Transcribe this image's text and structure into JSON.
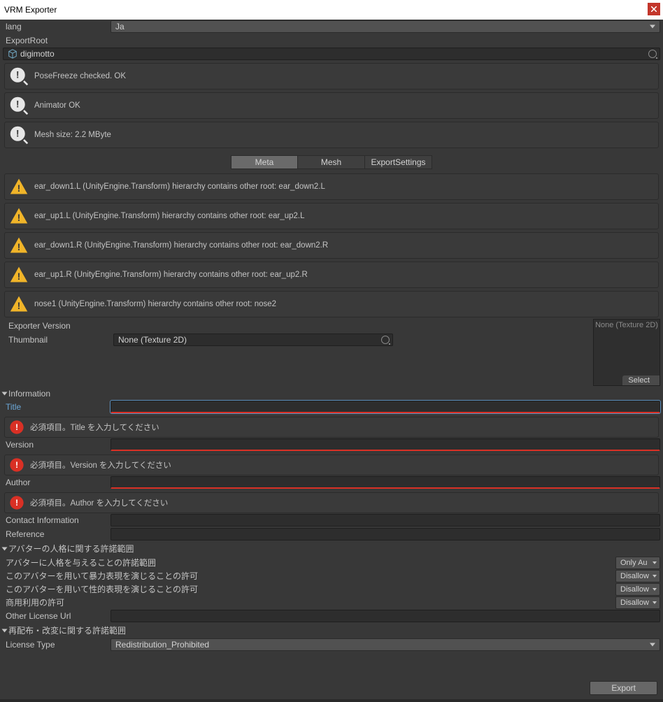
{
  "window": {
    "title": "VRM Exporter"
  },
  "lang": {
    "label": "lang",
    "value": "Ja"
  },
  "exportRoot": {
    "label": "ExportRoot",
    "value": "digimotto"
  },
  "infos": [
    "PoseFreeze checked. OK",
    "Animator OK",
    "Mesh size: 2.2 MByte"
  ],
  "tabs": {
    "meta": "Meta",
    "mesh": "Mesh",
    "export": "ExportSettings"
  },
  "warnings": [
    "ear_down1.L (UnityEngine.Transform) hierarchy contains other root: ear_down2.L",
    "ear_up1.L (UnityEngine.Transform) hierarchy contains other root: ear_up2.L",
    "ear_down1.R (UnityEngine.Transform) hierarchy contains other root: ear_down2.R",
    "ear_up1.R (UnityEngine.Transform) hierarchy contains other root: ear_up2.R",
    "nose1 (UnityEngine.Transform) hierarchy contains other root: nose2"
  ],
  "exporterVersion": {
    "label": "Exporter Version",
    "value": ""
  },
  "thumbnail": {
    "label": "Thumbnail",
    "value": "None (Texture 2D)",
    "slotLabel": "None (Texture 2D)",
    "select": "Select"
  },
  "informationHeader": "Information",
  "fields": {
    "title": {
      "label": "Title",
      "value": "",
      "error": "必須項目。Title を入力してください"
    },
    "version": {
      "label": "Version",
      "value": "",
      "error": "必須項目。Version を入力してください"
    },
    "author": {
      "label": "Author",
      "value": "",
      "error": "必須項目。Author を入力してください"
    },
    "contact": {
      "label": "Contact Information",
      "value": ""
    },
    "reference": {
      "label": "Reference",
      "value": ""
    }
  },
  "permHeader": "アバターの人格に関する許諾範囲",
  "perms": {
    "personation": {
      "label": "アバターに人格を与えることの許諾範囲",
      "value": "Only Au"
    },
    "violence": {
      "label": "このアバターを用いて暴力表現を演じることの許可",
      "value": "Disallow"
    },
    "sexual": {
      "label": "このアバターを用いて性的表現を演じることの許可",
      "value": "Disallow"
    },
    "commercial": {
      "label": "商用利用の許可",
      "value": "Disallow"
    },
    "otherUrl": {
      "label": "Other License Url",
      "value": ""
    }
  },
  "redistHeader": "再配布・改変に関する許諾範囲",
  "license": {
    "label": "License Type",
    "value": "Redistribution_Prohibited"
  },
  "exportBtn": "Export"
}
